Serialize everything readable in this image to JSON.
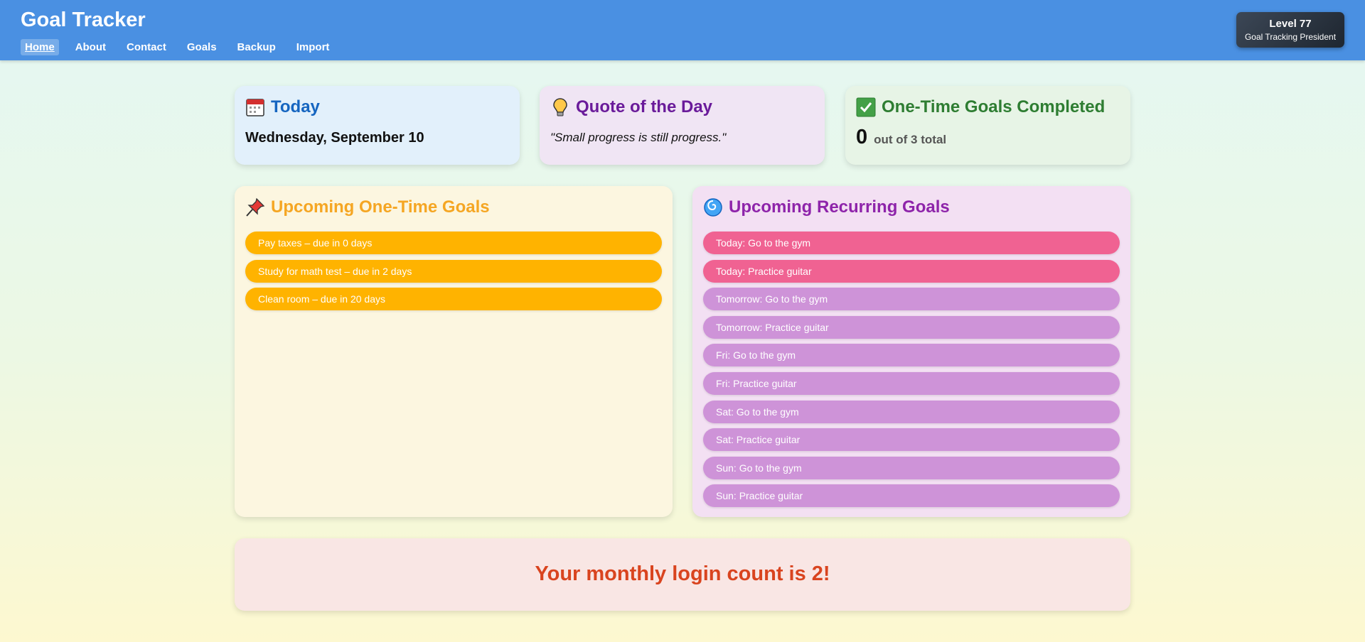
{
  "app": {
    "title": "Goal Tracker"
  },
  "nav": [
    {
      "label": "Home",
      "active": true
    },
    {
      "label": "About"
    },
    {
      "label": "Contact"
    },
    {
      "label": "Goals"
    },
    {
      "label": "Backup"
    },
    {
      "label": "Import"
    }
  ],
  "level": {
    "label": "Level 77",
    "title": "Goal Tracking President"
  },
  "today": {
    "icon": "calendar-icon",
    "heading": "Today",
    "date": "Wednesday, September 10"
  },
  "quote": {
    "icon": "lightbulb-icon",
    "heading": "Quote of the Day",
    "text": "\"Small progress is still progress.\""
  },
  "completed": {
    "icon": "checkmark-icon",
    "heading": "One-Time Goals Completed",
    "count": "0",
    "total_text": "out of 3 total"
  },
  "onetime": {
    "icon": "pushpin-icon",
    "heading": "Upcoming One-Time Goals",
    "items": [
      "Pay taxes – due in 0 days",
      "Study for math test – due in 2 days",
      "Clean room – due in 20 days"
    ]
  },
  "recurring": {
    "icon": "cyclone-icon",
    "heading": "Upcoming Recurring Goals",
    "items": [
      "Today: Go to the gym",
      "Today: Practice guitar",
      "Tomorrow: Go to the gym",
      "Tomorrow: Practice guitar",
      "Fri: Go to the gym",
      "Fri: Practice guitar",
      "Sat: Go to the gym",
      "Sat: Practice guitar",
      "Sun: Go to the gym",
      "Sun: Practice guitar"
    ]
  },
  "login": {
    "text": "Your monthly login count is 2!"
  },
  "colors": {
    "header": "#4a90e2",
    "today_heading": "#1565c0",
    "quote_heading": "#6a1b9a",
    "completed_heading": "#2e7d32",
    "onetime_heading": "#f5a623",
    "recurring_heading": "#8e24aa",
    "pill_onetime": "#ffb300",
    "pill_today": "#f06292",
    "pill_later": "#ce93d8",
    "login_text": "#d9441f"
  }
}
